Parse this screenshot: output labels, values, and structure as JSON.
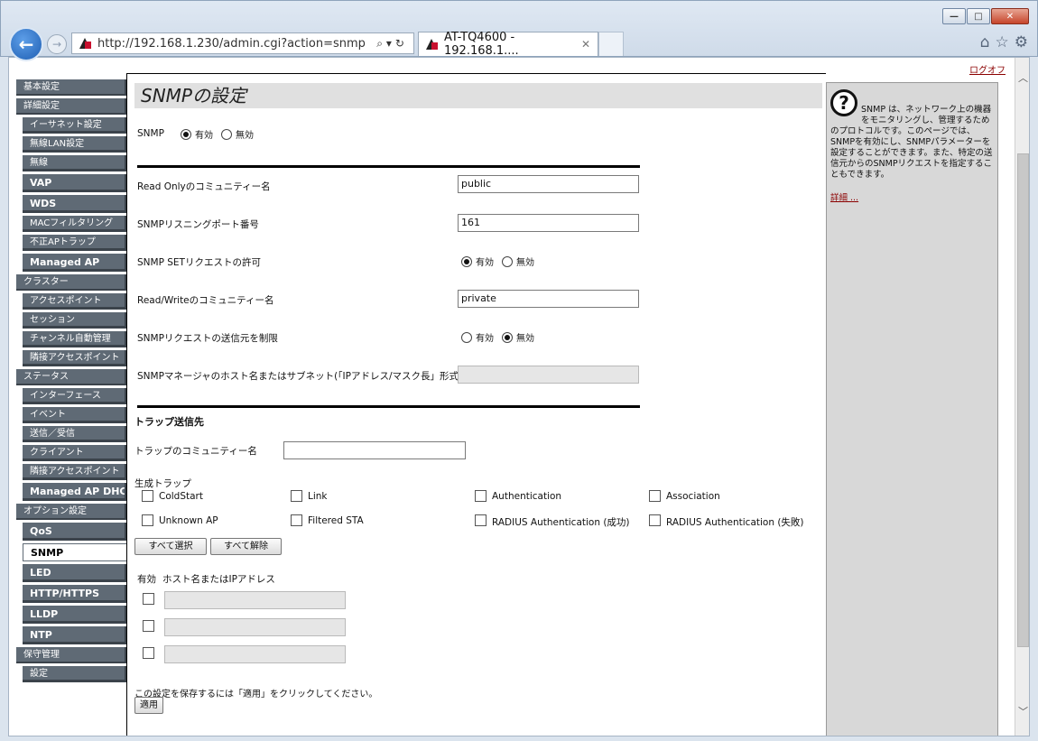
{
  "browser": {
    "url": "http://192.168.1.230/admin.cgi?action=snmp",
    "tab_title": "AT-TQ4600 - 192.168.1....",
    "win_min": "—",
    "win_max": "□",
    "win_close": "✕",
    "back": "←",
    "forward": "→",
    "addr_icons": "⌕▾↻",
    "home_icon": "⌂",
    "star_icon": "☆",
    "gear_icon": "⚙",
    "tab_close": "✕"
  },
  "logout": "ログオフ",
  "sidebar": [
    {
      "label": "基本設定",
      "type": "sec"
    },
    {
      "label": "詳細設定",
      "type": "sec"
    },
    {
      "label": "イーサネット設定",
      "type": "sub"
    },
    {
      "label": "無線LAN設定",
      "type": "sub"
    },
    {
      "label": "無線",
      "type": "sub"
    },
    {
      "label": "VAP",
      "type": "subbold"
    },
    {
      "label": "WDS",
      "type": "subbold"
    },
    {
      "label": "MACフィルタリング",
      "type": "sub"
    },
    {
      "label": "不正APトラップ",
      "type": "sub"
    },
    {
      "label": "Managed AP",
      "type": "subbold"
    },
    {
      "label": "クラスター",
      "type": "sec"
    },
    {
      "label": "アクセスポイント",
      "type": "sub"
    },
    {
      "label": "セッション",
      "type": "sub"
    },
    {
      "label": "チャンネル自動管理",
      "type": "sub"
    },
    {
      "label": "隣接アクセスポイント",
      "type": "sub"
    },
    {
      "label": "ステータス",
      "type": "sec"
    },
    {
      "label": "インターフェース",
      "type": "sub"
    },
    {
      "label": "イベント",
      "type": "sub"
    },
    {
      "label": "送信／受信",
      "type": "sub"
    },
    {
      "label": "クライアント",
      "type": "sub"
    },
    {
      "label": "隣接アクセスポイント",
      "type": "sub"
    },
    {
      "label": "Managed AP DHCP",
      "type": "subbold"
    },
    {
      "label": "オプション設定",
      "type": "sec"
    },
    {
      "label": "QoS",
      "type": "subbold"
    },
    {
      "label": "SNMP",
      "type": "active"
    },
    {
      "label": "LED",
      "type": "subbold"
    },
    {
      "label": "HTTP/HTTPS",
      "type": "subbold"
    },
    {
      "label": "LLDP",
      "type": "subbold"
    },
    {
      "label": "NTP",
      "type": "subbold"
    },
    {
      "label": "保守管理",
      "type": "sec"
    },
    {
      "label": "設定",
      "type": "sub"
    }
  ],
  "main": {
    "title": "SNMPの設定",
    "snmp_label": "SNMP",
    "enable": "有効",
    "disable": "無効",
    "snmp_state": "enabled",
    "ro_community_label": "Read Onlyのコミュニティー名",
    "ro_community_value": "public",
    "port_label": "SNMPリスニングポート番号",
    "port_value": "161",
    "set_request_label": "SNMP SETリクエストの許可",
    "set_request_state": "enabled",
    "rw_community_label": "Read/Writeのコミュニティー名",
    "rw_community_value": "private",
    "restrict_source_label": "SNMPリクエストの送信元を制限",
    "restrict_source_state": "disabled",
    "manager_host_label": "SNMPマネージャのホスト名またはサブネット(「IPアドレス/マスク長」形式)",
    "manager_host_value": "",
    "trap_heading": "トラップ送信先",
    "trap_community_label": "トラップのコミュニティー名",
    "trap_community_value": "",
    "generate_traps_label": "生成トラップ",
    "traps": [
      "ColdStart",
      "Link",
      "Authentication",
      "Association",
      "Unknown AP",
      "Filtered STA",
      "RADIUS Authentication (成功)",
      "RADIUS Authentication (失敗)"
    ],
    "select_all": "すべて選択",
    "clear_all": "すべて解除",
    "hosts_enabled_header": "有効",
    "hosts_address_header": "ホスト名またはIPアドレス",
    "save_note": "この設定を保存するには「適用」をクリックしてください。",
    "apply": "適用"
  },
  "help": {
    "icon": "?",
    "text": "SNMP は、ネットワーク上の機器をモニタリングし、管理するためのプロトコルです。このページでは、SNMPを有効にし、SNMPパラメーターを設定することができます。また、特定の送信元からのSNMPリクエストを指定することもできます。",
    "more": "詳細 ..."
  },
  "scrollbar": {
    "up": "︿",
    "down": "﹀"
  }
}
